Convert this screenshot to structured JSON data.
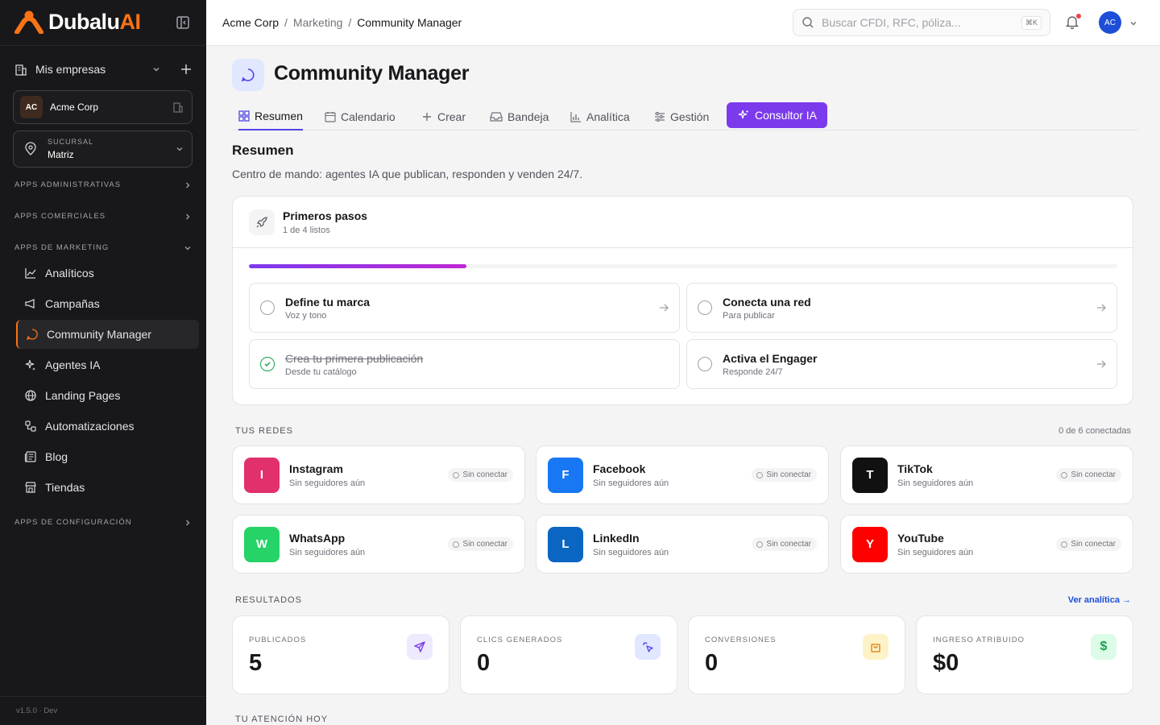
{
  "brand": {
    "name_part1": "Dubalu",
    "name_part2": "AI",
    "accent": "#f97316"
  },
  "sidebar": {
    "my_companies": "Mis empresas",
    "company": {
      "initials": "AC",
      "name": "Acme Corp"
    },
    "branch": {
      "label": "SUCURSAL",
      "value": "Matriz"
    },
    "sections": {
      "admin": "APPS ADMINISTRATIVAS",
      "commercial": "APPS COMERCIALES",
      "marketing": "APPS DE MARKETING",
      "config": "APPS DE CONFIGURACIÓN"
    },
    "marketing_items": [
      {
        "label": "Analíticos",
        "icon": "chart-line-icon"
      },
      {
        "label": "Campañas",
        "icon": "megaphone-icon"
      },
      {
        "label": "Community Manager",
        "icon": "chat-bubble-icon",
        "active": true
      },
      {
        "label": "Agentes IA",
        "icon": "sparkles-icon"
      },
      {
        "label": "Landing Pages",
        "icon": "globe-icon"
      },
      {
        "label": "Automatizaciones",
        "icon": "workflow-icon"
      },
      {
        "label": "Blog",
        "icon": "newspaper-icon"
      },
      {
        "label": "Tiendas",
        "icon": "store-icon"
      }
    ],
    "version": "v1.5.0 · Dev"
  },
  "topbar": {
    "breadcrumb": [
      "Acme Corp",
      "Marketing",
      "Community Manager"
    ],
    "search_placeholder": "Buscar CFDI, RFC, póliza...",
    "search_shortcut": "⌘K",
    "avatar_initials": "AC"
  },
  "page": {
    "title": "Community Manager",
    "tabs": [
      "Resumen",
      "Calendario",
      "Crear",
      "Bandeja",
      "Analítica",
      "Gestión"
    ],
    "ai_tab": "Consultor IA",
    "section_title": "Resumen",
    "section_subtitle": "Centro de mando: agentes IA que publican, responden y venden 24/7."
  },
  "first_steps": {
    "title": "Primeros pasos",
    "count": "1 de 4 listos",
    "progress": 0.25,
    "steps": [
      {
        "title": "Define tu marca",
        "subtitle": "Voz y tono",
        "done": false
      },
      {
        "title": "Conecta una red",
        "subtitle": "Para publicar",
        "done": false
      },
      {
        "title": "Crea tu primera publicación",
        "subtitle": "Desde tu catálogo",
        "done": true
      },
      {
        "title": "Activa el Engager",
        "subtitle": "Responde 24/7",
        "done": false
      }
    ]
  },
  "networks": {
    "label": "TUS REDES",
    "connected": "0 de 6 conectadas",
    "items": [
      {
        "letter": "I",
        "name": "Instagram",
        "sub": "Sin seguidores aún",
        "status": "Sin conectar",
        "color": "#e1306c"
      },
      {
        "letter": "F",
        "name": "Facebook",
        "sub": "Sin seguidores aún",
        "status": "Sin conectar",
        "color": "#1877f2"
      },
      {
        "letter": "T",
        "name": "TikTok",
        "sub": "Sin seguidores aún",
        "status": "Sin conectar",
        "color": "#111111"
      },
      {
        "letter": "W",
        "name": "WhatsApp",
        "sub": "Sin seguidores aún",
        "status": "Sin conectar",
        "color": "#25d366"
      },
      {
        "letter": "L",
        "name": "LinkedIn",
        "sub": "Sin seguidores aún",
        "status": "Sin conectar",
        "color": "#0a66c2"
      },
      {
        "letter": "Y",
        "name": "YouTube",
        "sub": "Sin seguidores aún",
        "status": "Sin conectar",
        "color": "#ff0000"
      }
    ]
  },
  "results": {
    "label": "RESULTADOS",
    "link": "Ver analítica →",
    "kpis": [
      {
        "label": "PUBLICADOS",
        "value": "5",
        "icon": "send-icon",
        "bg": "#ede9fe",
        "fg": "#7c3aed"
      },
      {
        "label": "CLICS GENERADOS",
        "value": "0",
        "icon": "cursor-click-icon",
        "bg": "#e0e7ff",
        "fg": "#4f46e5"
      },
      {
        "label": "CONVERSIONES",
        "value": "0",
        "icon": "shopping-bag-icon",
        "bg": "#fef3c7",
        "fg": "#d97706"
      },
      {
        "label": "INGRESO ATRIBUIDO",
        "value": "$0",
        "icon": "dollar-icon",
        "bg": "#dcfce7",
        "fg": "#16a34a"
      }
    ]
  },
  "attention": {
    "label": "TU ATENCIÓN HOY"
  }
}
